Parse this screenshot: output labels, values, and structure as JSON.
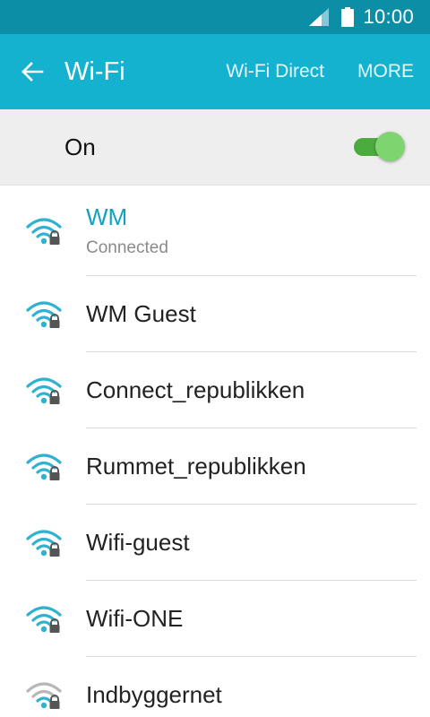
{
  "status_bar": {
    "time": "10:00",
    "signal_icon": "signal-icon",
    "battery_icon": "battery-icon"
  },
  "action_bar": {
    "back_icon": "back-arrow-icon",
    "title": "Wi-Fi",
    "wifi_direct_label": "Wi-Fi Direct",
    "more_label": "MORE"
  },
  "master_switch": {
    "label": "On",
    "state": "on"
  },
  "networks": [
    {
      "name": "WM",
      "status": "Connected",
      "connected": true,
      "secured": true,
      "icon": "wifi-lock-icon"
    },
    {
      "name": "WM Guest",
      "secured": true,
      "icon": "wifi-lock-icon"
    },
    {
      "name": "Connect_republikken",
      "secured": true,
      "icon": "wifi-lock-icon"
    },
    {
      "name": "Rummet_republikken",
      "secured": true,
      "icon": "wifi-lock-icon"
    },
    {
      "name": "Wifi-guest",
      "secured": true,
      "icon": "wifi-lock-icon"
    },
    {
      "name": "Wifi-ONE",
      "secured": true,
      "icon": "wifi-lock-icon"
    },
    {
      "name": "Indbyggernet",
      "secured": true,
      "weak": true,
      "icon": "wifi-lock-icon"
    }
  ],
  "colors": {
    "status_bar": "#0b8ea6",
    "action_bar": "#14b2cf",
    "accent": "#12a2c0",
    "switch_on": "#7ed56f",
    "signal_strong": "#2fb2d2",
    "signal_weak": "#b7b7b7"
  }
}
